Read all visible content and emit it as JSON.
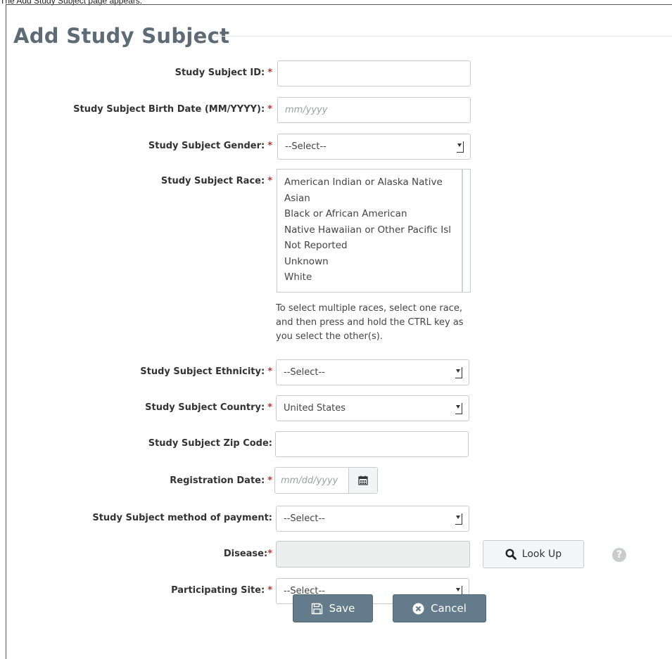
{
  "caption": "The Add Study Subject page appears.",
  "page_title": "Add Study Subject",
  "required_marker": "*",
  "fields": {
    "subject_id": {
      "label": "Study Subject ID:",
      "value": ""
    },
    "birth_date": {
      "label": "Study Subject Birth Date (MM/YYYY):",
      "placeholder": "mm/yyyy"
    },
    "gender": {
      "label": "Study Subject Gender:",
      "value": "--Select--"
    },
    "race": {
      "label": "Study Subject Race:",
      "options": [
        "American Indian or Alaska Native",
        "Asian",
        "Black or African American",
        "Native Hawaiian or Other Pacific Isl",
        "Not Reported",
        "Unknown",
        "White"
      ],
      "help": "To select multiple races, select one race, and then press and hold the CTRL key as you select the other(s)."
    },
    "ethnicity": {
      "label": "Study Subject Ethnicity:",
      "value": "--Select--"
    },
    "country": {
      "label": "Study Subject Country:",
      "value": "United States"
    },
    "zip": {
      "label": "Study Subject Zip Code:",
      "value": ""
    },
    "registration_date": {
      "label": "Registration Date:",
      "placeholder": "mm/dd/yyyy"
    },
    "payment": {
      "label": "Study Subject method of payment:",
      "value": "--Select--"
    },
    "disease": {
      "label": "Disease:",
      "value": "",
      "lookup_label": "Look Up"
    },
    "site": {
      "label": "Participating Site:",
      "value": "--Select--"
    }
  },
  "buttons": {
    "save": "Save",
    "cancel": "Cancel"
  },
  "colors": {
    "title": "#5d6b75",
    "required": "#c9302c",
    "button": "#637b8a"
  }
}
